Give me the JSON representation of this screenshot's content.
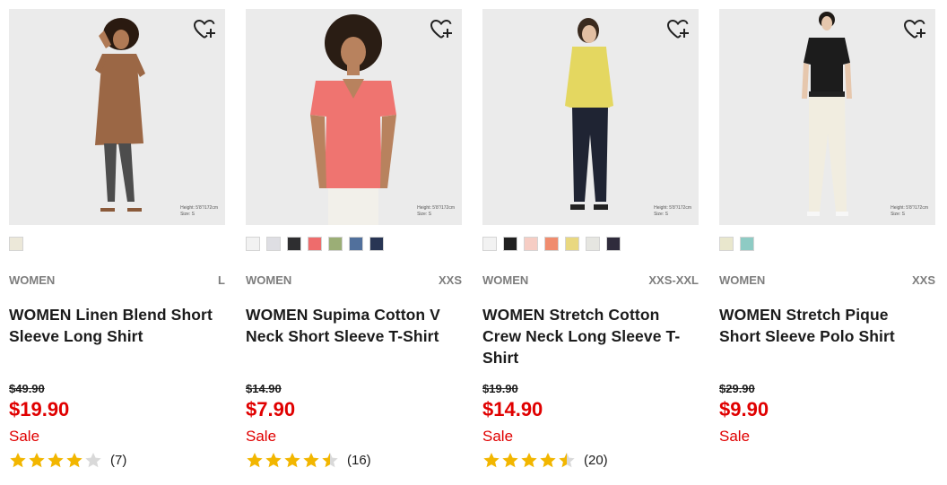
{
  "colors": {
    "accent_red": "#e00000",
    "star_gold": "#f2b600",
    "star_empty": "#d9d9d9"
  },
  "products": [
    {
      "photo_alt": "Model wearing brown linen long shirt",
      "model_height": "Height: 5'8\"/172cm",
      "model_size": "Size: S",
      "swatches": [
        "#ece8d9"
      ],
      "gender": "WOMEN",
      "sizes": "L",
      "name": "WOMEN Linen Blend Short Sleeve Long Shirt",
      "original_price": "$49.90",
      "price": "$19.90",
      "flag": "Sale",
      "rating": 4,
      "review_count": "(7)"
    },
    {
      "photo_alt": "Model wearing coral V-neck T-shirt",
      "model_height": "Height: 5'8\"/172cm",
      "model_size": "Size: S",
      "swatches": [
        "#f2f2f2",
        "#dedee3",
        "#2e2e30",
        "#ee6c6c",
        "#9bae76",
        "#51709c",
        "#283554"
      ],
      "gender": "WOMEN",
      "sizes": "XXS",
      "name": "WOMEN Supima Cotton V Neck Short Sleeve T-Shirt",
      "original_price": "$14.90",
      "price": "$7.90",
      "flag": "Sale",
      "rating": 4.5,
      "review_count": "(16)"
    },
    {
      "photo_alt": "Model wearing yellow crew neck long sleeve T-shirt",
      "model_height": "Height: 5'8\"/172cm",
      "model_size": "Size: S",
      "swatches": [
        "#f2f2f2",
        "#202020",
        "#f6cdc4",
        "#f08c6e",
        "#e9d880",
        "#e6e6e1",
        "#2f2b3c"
      ],
      "gender": "WOMEN",
      "sizes": "XXS-XXL",
      "name": "WOMEN Stretch Cotton Crew Neck Long Sleeve T-Shirt",
      "original_price": "$19.90",
      "price": "$14.90",
      "flag": "Sale",
      "rating": 4.5,
      "review_count": "(20)"
    },
    {
      "photo_alt": "Model wearing black short sleeve polo shirt",
      "model_height": "Height: 5'8\"/172cm",
      "model_size": "Size: S",
      "swatches": [
        "#e9e7cd",
        "#8ecbc4"
      ],
      "gender": "WOMEN",
      "sizes": "XXS",
      "name": "WOMEN Stretch Pique Short Sleeve Polo Shirt",
      "original_price": "$29.90",
      "price": "$9.90",
      "flag": "Sale",
      "rating": null,
      "review_count": ""
    }
  ]
}
